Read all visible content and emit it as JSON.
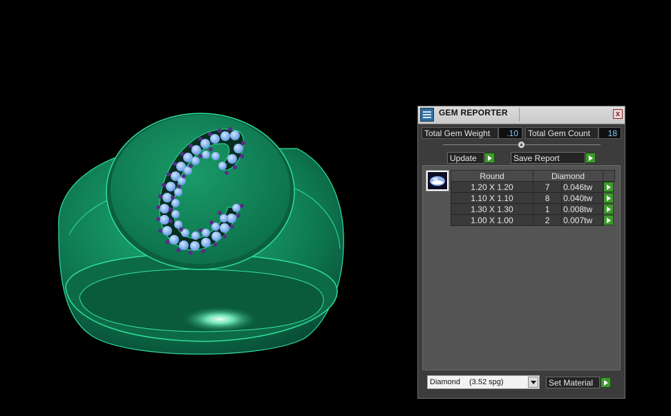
{
  "viewport": {
    "description_icon": "ring-3d-model",
    "colors": {
      "background": "#000000",
      "metal": "#118a5c",
      "gem": "#7fb6f2",
      "prong": "#5b2a8a"
    }
  },
  "panel": {
    "title": "GEM REPORTER",
    "close_label": "x",
    "stats": {
      "weight_label": "Total Gem Weight",
      "weight_value": ".10",
      "count_label": "Total Gem Count",
      "count_value": "18"
    },
    "buttons": {
      "update": "Update",
      "save_report": "Save Report",
      "set_material": "Set Material"
    },
    "table": {
      "headers": {
        "shape": "Round",
        "material": "Diamond"
      },
      "rows": [
        {
          "size": "1.20 X 1.20",
          "count": "7",
          "weight": "0.046tw"
        },
        {
          "size": "1.10 X 1.10",
          "count": "8",
          "weight": "0.040tw"
        },
        {
          "size": "1.30 X 1.30",
          "count": "1",
          "weight": "0.008tw"
        },
        {
          "size": "1.00 X 1.00",
          "count": "2",
          "weight": "0.007tw"
        }
      ]
    },
    "material_select": {
      "name": "Diamond",
      "spg": "(3.52 spg)"
    },
    "colors": {
      "accent_green": "#3f9a2e",
      "value_blue": "#7fd0ff",
      "panel_bg": "#3c3c3c"
    }
  }
}
